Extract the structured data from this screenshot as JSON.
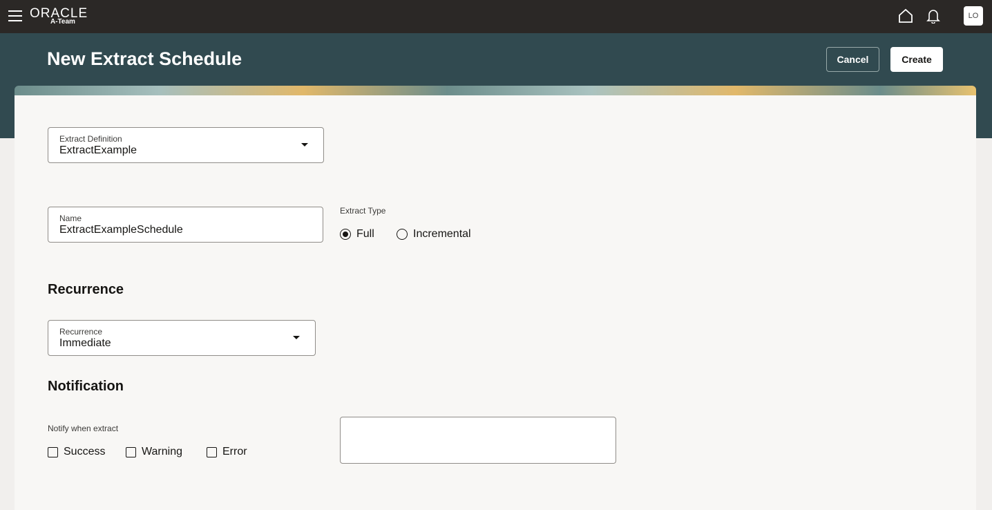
{
  "topbar": {
    "brand": "ORACLE",
    "subbrand": "A-Team",
    "avatar": "LO"
  },
  "header": {
    "title": "New Extract Schedule",
    "cancel_label": "Cancel",
    "create_label": "Create"
  },
  "form": {
    "extract_definition": {
      "label": "Extract Definition",
      "value": "ExtractExample"
    },
    "name": {
      "label": "Name",
      "value": "ExtractExampleSchedule"
    },
    "extract_type": {
      "label": "Extract Type",
      "options": [
        "Full",
        "Incremental"
      ],
      "selected": "Full"
    },
    "recurrence_heading": "Recurrence",
    "recurrence": {
      "label": "Recurrence",
      "value": "Immediate"
    },
    "notification_heading": "Notification",
    "notify": {
      "label": "Notify when extract",
      "options": [
        "Success",
        "Warning",
        "Error"
      ]
    },
    "notification_text": ""
  }
}
